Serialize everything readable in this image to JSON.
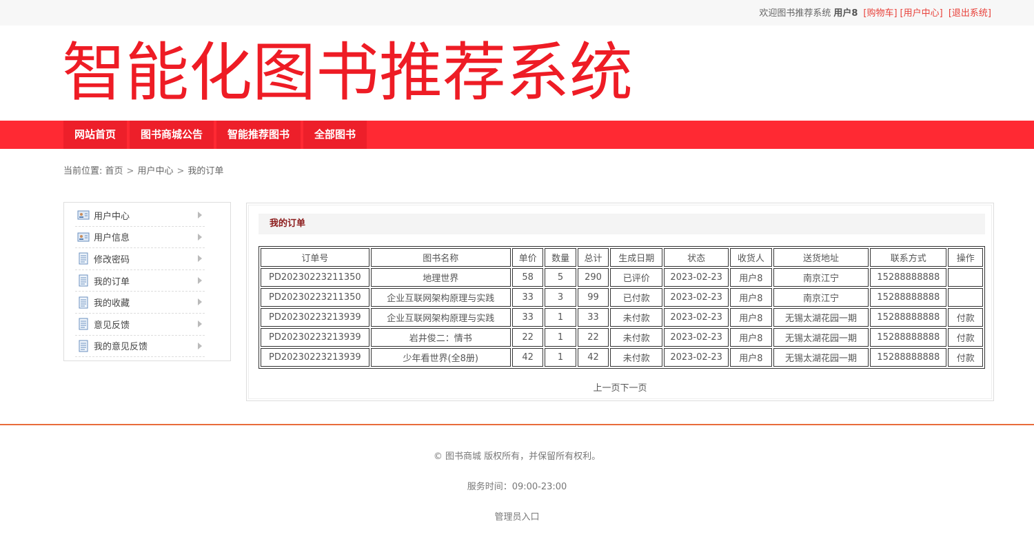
{
  "topbar": {
    "welcome": "欢迎图书推荐系统",
    "username": "用户8",
    "links": [
      "[购物车]",
      "[用户中心]",
      "[退出系统]"
    ]
  },
  "logo": {
    "text": "智能化图书推荐系统",
    "color": "#ee1c25"
  },
  "nav": {
    "items": [
      "网站首页",
      "图书商城公告",
      "智能推荐图书",
      "全部图书"
    ],
    "bg": "#ff2933"
  },
  "breadcrumb": {
    "prefix": "当前位置:",
    "items": [
      "首页",
      "用户中心",
      "我的订单"
    ]
  },
  "sidebar": {
    "items": [
      {
        "label": "用户中心",
        "icon": "id-card-icon"
      },
      {
        "label": "用户信息",
        "icon": "id-card-icon"
      },
      {
        "label": "修改密码",
        "icon": "document-icon"
      },
      {
        "label": "我的订单",
        "icon": "document-icon"
      },
      {
        "label": "我的收藏",
        "icon": "document-icon"
      },
      {
        "label": "意见反馈",
        "icon": "document-icon"
      },
      {
        "label": "我的意见反馈",
        "icon": "document-icon"
      }
    ]
  },
  "orders": {
    "title": "我的订单",
    "columns": [
      "订单号",
      "图书名称",
      "单价",
      "数量",
      "总计",
      "生成日期",
      "状态",
      "收货人",
      "送货地址",
      "联系方式",
      "操作"
    ],
    "rows": [
      [
        "PD20230223211350",
        "地理世界",
        "58",
        "5",
        "290",
        "已评价",
        "2023-02-23",
        "用户8",
        "南京江宁",
        "15288888888",
        ""
      ],
      [
        "PD20230223211350",
        "企业互联网架构原理与实践",
        "33",
        "3",
        "99",
        "已付款",
        "2023-02-23",
        "用户8",
        "南京江宁",
        "15288888888",
        ""
      ],
      [
        "PD20230223213939",
        "企业互联网架构原理与实践",
        "33",
        "1",
        "33",
        "未付款",
        "2023-02-23",
        "用户8",
        "无锡太湖花园一期",
        "15288888888",
        "付款"
      ],
      [
        "PD20230223213939",
        "岩井俊二：情书",
        "22",
        "1",
        "22",
        "未付款",
        "2023-02-23",
        "用户8",
        "无锡太湖花园一期",
        "15288888888",
        "付款"
      ],
      [
        "PD20230223213939",
        "少年看世界(全8册)",
        "42",
        "1",
        "42",
        "未付款",
        "2023-02-23",
        "用户8",
        "无锡太湖花园一期",
        "15288888888",
        "付款"
      ]
    ],
    "pager": {
      "prev": "上一页",
      "next": "下一页"
    }
  },
  "footer": {
    "copyright": "© 图书商城 版权所有，并保留所有权利。",
    "hours": "服务时间：09:00-23:00",
    "admin": "管理员入口"
  }
}
